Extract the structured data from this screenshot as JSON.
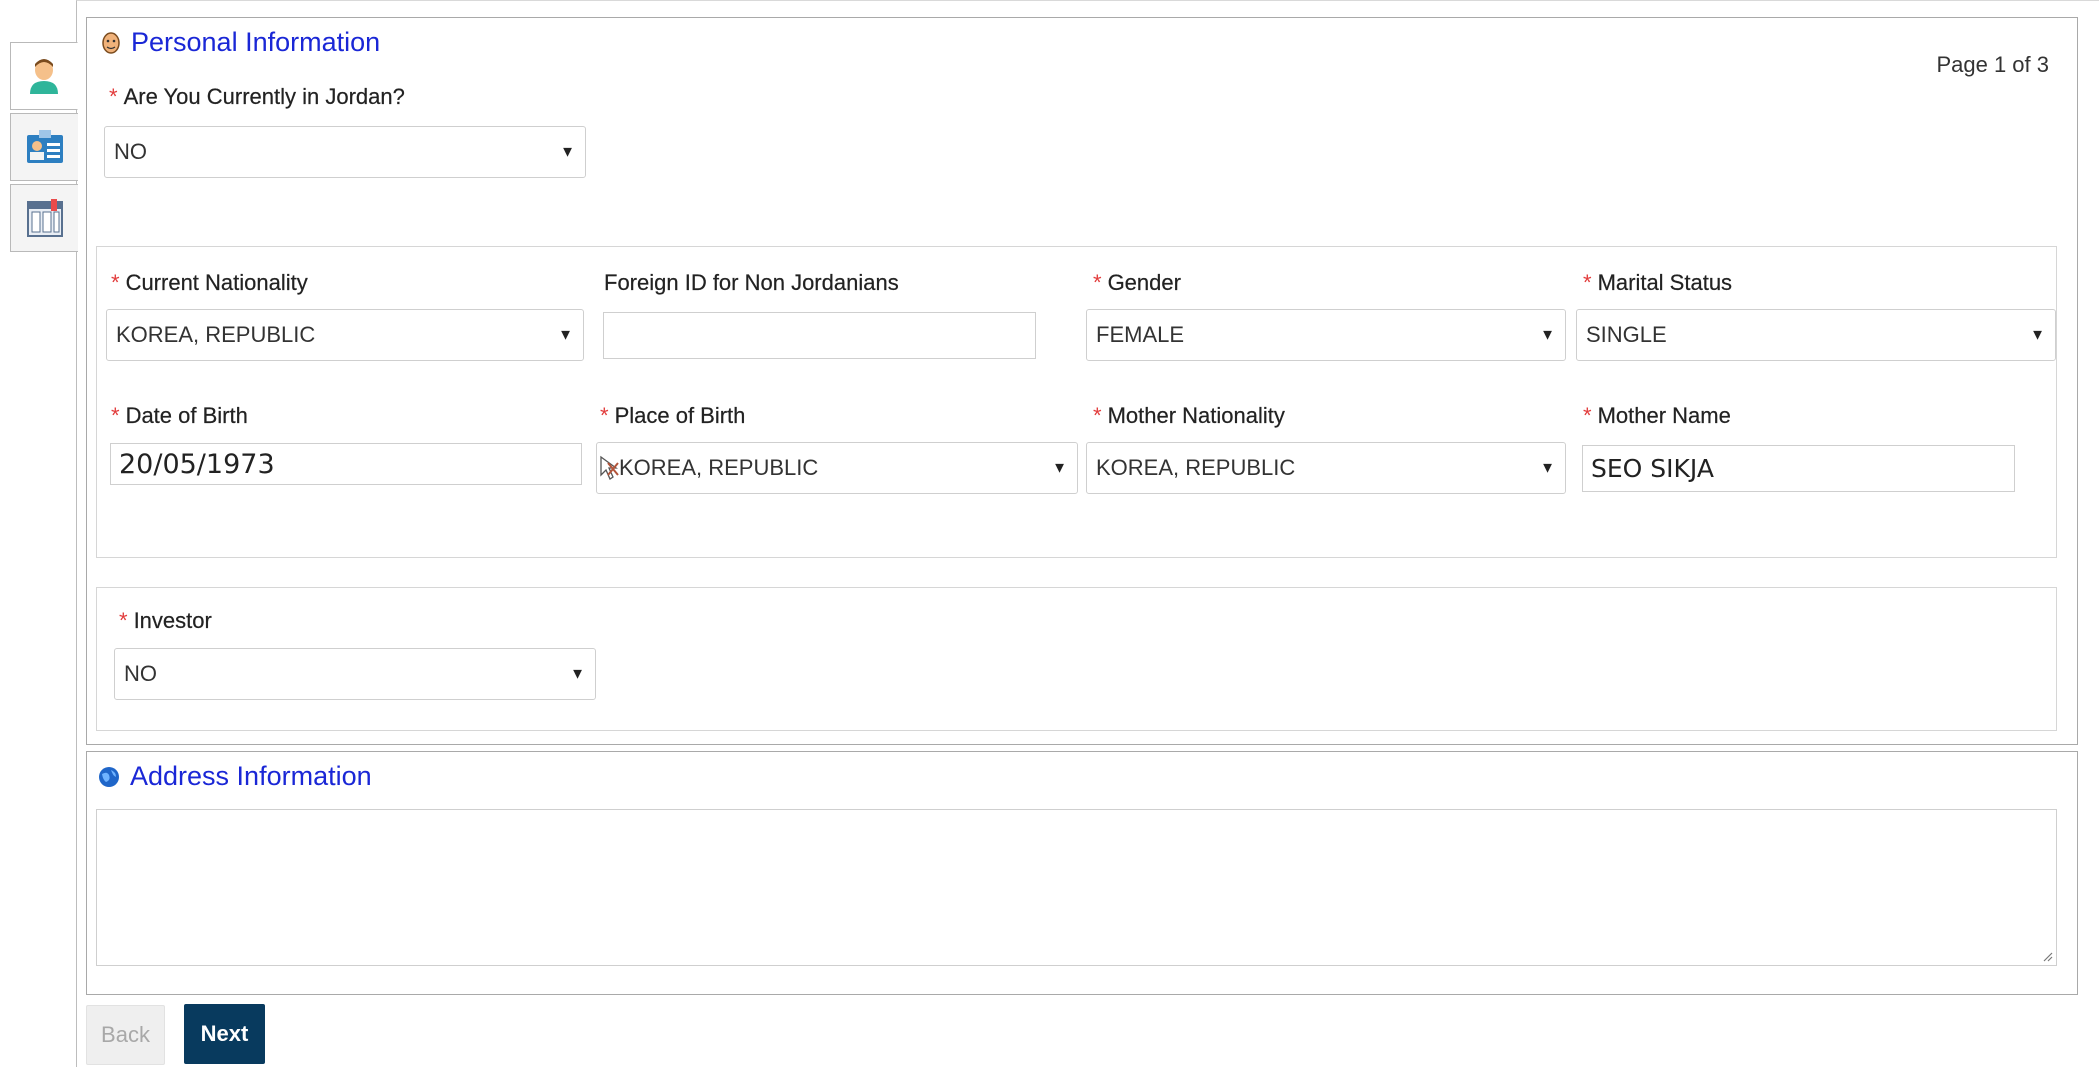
{
  "side_tabs": [
    {
      "name": "personal-tab",
      "icon": "person-icon"
    },
    {
      "name": "id-card-tab",
      "icon": "id-card-icon"
    },
    {
      "name": "calendar-tab",
      "icon": "calendar-icon"
    }
  ],
  "personal": {
    "title": "Personal Information",
    "page_indicator": "Page 1 of 3",
    "in_jordan_label": "Are You Currently in Jordan?",
    "in_jordan_value": "NO",
    "current_nationality_label": "Current Nationality",
    "current_nationality_value": "KOREA, REPUBLIC",
    "foreign_id_label": "Foreign ID for Non Jordanians",
    "foreign_id_value": "",
    "gender_label": "Gender",
    "gender_value": "FEMALE",
    "marital_label": "Marital Status",
    "marital_value": "SINGLE",
    "dob_label": "Date of Birth",
    "dob_value": "20/05/1973",
    "place_label": "Place of Birth",
    "place_value": "KOREA, REPUBLIC",
    "mother_nat_label": "Mother Nationality",
    "mother_nat_value": "KOREA, REPUBLIC",
    "mother_name_label": "Mother Name",
    "mother_name_value": "SEO SIKJA",
    "investor_label": "Investor",
    "investor_value": "NO"
  },
  "address": {
    "title": "Address Information"
  },
  "buttons": {
    "back": "Back",
    "next": "Next"
  },
  "required_mark": "*",
  "dropdown_arrow": "▼",
  "colors": {
    "title": "#1a27d6",
    "required": "#e23c3c",
    "next_button": "#083a5e"
  }
}
